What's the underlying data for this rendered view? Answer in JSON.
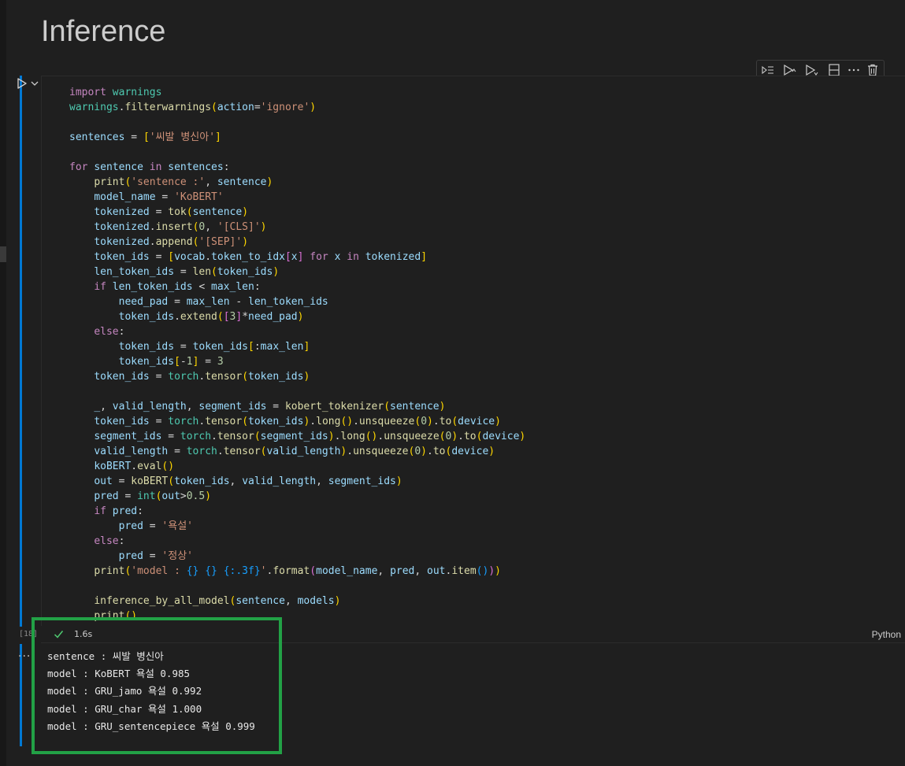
{
  "markdown": {
    "heading": "Inference"
  },
  "cell": {
    "execution_count": "[18]",
    "status": {
      "duration": "1.6s",
      "language": "Python"
    },
    "toolbar": [
      "Execute Above Cells",
      "Execute Cell and Below",
      "Execute Cell and Advance",
      "Split Cell",
      "More Actions",
      "Delete Cell"
    ],
    "code_lines": [
      "import warnings",
      "warnings.filterwarnings(action='ignore')",
      "",
      "sentences = ['씨발 병신아']",
      "",
      "for sentence in sentences:",
      "    print('sentence :', sentence)",
      "    model_name = 'KoBERT'",
      "    tokenized = tok(sentence)",
      "    tokenized.insert(0, '[CLS]')",
      "    tokenized.append('[SEP]')",
      "    token_ids = [vocab.token_to_idx[x] for x in tokenized]",
      "    len_token_ids = len(token_ids)",
      "    if len_token_ids < max_len:",
      "        need_pad = max_len - len_token_ids",
      "        token_ids.extend([3]*need_pad)",
      "    else:",
      "        token_ids = token_ids[:max_len]",
      "        token_ids[-1] = 3",
      "    token_ids = torch.tensor(token_ids)",
      "",
      "    _, valid_length, segment_ids = kobert_tokenizer(sentence)",
      "    token_ids = torch.tensor(token_ids).long().unsqueeze(0).to(device)",
      "    segment_ids = torch.tensor(segment_ids).long().unsqueeze(0).to(device)",
      "    valid_length = torch.tensor(valid_length).unsqueeze(0).to(device)",
      "    koBERT.eval()",
      "    out = koBERT(token_ids, valid_length, segment_ids)",
      "    pred = int(out>0.5)",
      "    if pred:",
      "        pred = '욕설'",
      "    else:",
      "        pred = '정상'",
      "    print('model : {} {} {:.3f}'.format(model_name, pred, out.item()))",
      "",
      "    inference_by_all_model(sentence, models)",
      "    print()"
    ]
  },
  "output": {
    "lines": [
      "sentence : 씨발 병신아",
      "model : KoBERT 욕설 0.985",
      "model : GRU_jamo 욕설 0.992",
      "model : GRU_char 욕설 1.000",
      "model : GRU_sentencepiece 욕설 0.999"
    ]
  },
  "colors": {
    "highlight": "#22a146",
    "focus": "#0078d4",
    "background": "#1f1f1f"
  }
}
